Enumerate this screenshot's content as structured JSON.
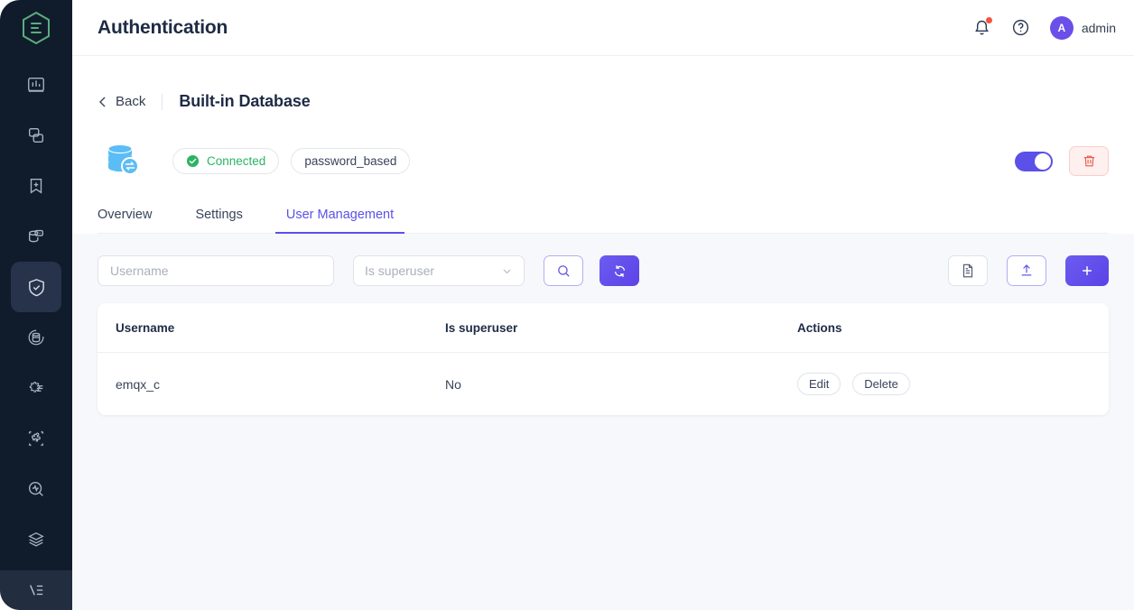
{
  "sidebar": {
    "logo_name": "emqx-logo",
    "items": [
      {
        "icon": "dashboard-chart-icon",
        "name": "sidebar-item-dashboard",
        "active": false
      },
      {
        "icon": "clients-copy-icon",
        "name": "sidebar-item-clients",
        "active": false
      },
      {
        "icon": "topics-bookmark-plus-icon",
        "name": "sidebar-item-topics",
        "active": false
      },
      {
        "icon": "retained-message-db-icon",
        "name": "sidebar-item-retained",
        "active": false
      },
      {
        "icon": "access-control-shield-check-icon",
        "name": "sidebar-item-access-control",
        "active": true
      },
      {
        "icon": "data-integration-sync-db-icon",
        "name": "sidebar-item-data-integration",
        "active": false
      },
      {
        "icon": "management-gear-list-icon",
        "name": "sidebar-item-management",
        "active": false
      },
      {
        "icon": "extensions-puzzle-icon",
        "name": "sidebar-item-extensions",
        "active": false
      },
      {
        "icon": "diagnose-pulse-search-icon",
        "name": "sidebar-item-diagnose",
        "active": false
      },
      {
        "icon": "cluster-layers-icon",
        "name": "sidebar-item-cluster",
        "active": false
      }
    ],
    "footer_icon": "collapse-sidebar-icon"
  },
  "header": {
    "title": "Authentication",
    "notification_icon": "bell-icon",
    "has_notification_dot": true,
    "help_icon": "help-circle-icon",
    "avatar_initial": "A",
    "user_name": "admin"
  },
  "breadcrumb": {
    "back_icon": "chevron-left-icon",
    "back_label": "Back",
    "title": "Built-in Database"
  },
  "status": {
    "db_icon": "database-sync-icon",
    "connected_icon": "check-circle-icon",
    "connected_label": "Connected",
    "mechanism_label": "password_based",
    "toggle_on": true,
    "delete_icon": "trash-icon"
  },
  "tabs": [
    {
      "label": "Overview",
      "name": "tab-overview",
      "active": false
    },
    {
      "label": "Settings",
      "name": "tab-settings",
      "active": false
    },
    {
      "label": "User Management",
      "name": "tab-user-management",
      "active": true
    }
  ],
  "toolbar": {
    "username_placeholder": "Username",
    "superuser_placeholder": "Is superuser",
    "chevron_icon": "chevron-down-icon",
    "search_icon": "search-icon",
    "refresh_icon": "refresh-icon",
    "document_icon": "document-icon",
    "import_icon": "upload-icon",
    "add_icon": "plus-icon"
  },
  "table": {
    "columns": [
      "Username",
      "Is superuser",
      "Actions"
    ],
    "rows": [
      {
        "username": "emqx_c",
        "is_superuser": "No",
        "edit_label": "Edit",
        "delete_label": "Delete"
      }
    ]
  },
  "colors": {
    "sidebar_bg": "#101C2B",
    "sidebar_active": "#26334A",
    "accent": "#5B50E8",
    "logo_green": "#5BAE7C",
    "connected_green": "#2BB463",
    "danger": "#E8584A",
    "db_blue": "#5BBDF5",
    "page_bg": "#F7F8FB",
    "title_navy": "#1E2B45"
  }
}
